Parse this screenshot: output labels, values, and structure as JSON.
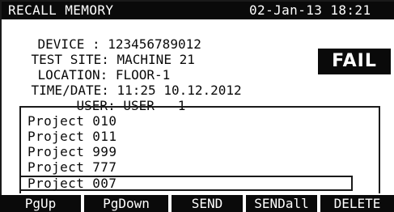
{
  "header": {
    "title": "RECALL MEMORY",
    "datetime": "02-Jan-13 18:21"
  },
  "info": {
    "device": {
      "label": "DEVICE",
      "value": "123456789012"
    },
    "test_site": {
      "label": "TEST SITE",
      "value": "MACHINE 21"
    },
    "location": {
      "label": "LOCATION",
      "value": "FLOOR-1"
    },
    "time_date": {
      "label": "TIME/DATE",
      "value": "11:25 10.12.2012"
    },
    "user": {
      "label": "USER",
      "value": "USER   1"
    },
    "separator": ":"
  },
  "result": {
    "status": "FAIL"
  },
  "projects": {
    "items": [
      "Project 010",
      "Project 011",
      "Project 999",
      "Project 777",
      "Project 007"
    ],
    "selected_index": 4
  },
  "softkeys": [
    "PgUp",
    "PgDown",
    "SEND",
    "SENDall",
    "DELETE"
  ]
}
